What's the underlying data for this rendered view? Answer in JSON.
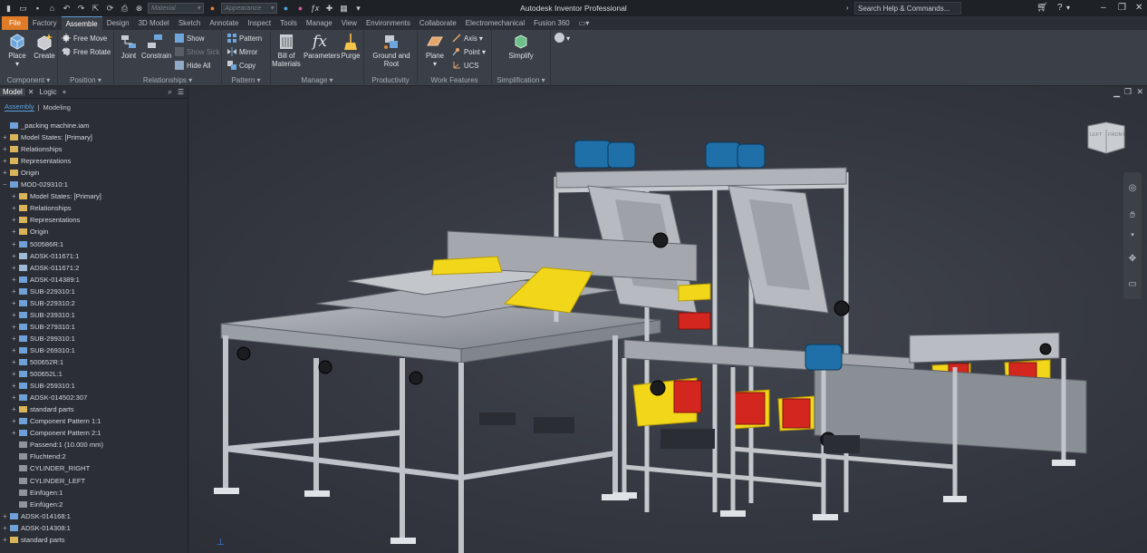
{
  "window": {
    "title": "Autodesk Inventor Professional",
    "search": "Search Help & Commands..."
  },
  "quick_access": {
    "material_placeholder": "Material",
    "appearance_placeholder": "Appearance"
  },
  "tabs": [
    "File",
    "Factory",
    "Assemble",
    "Design",
    "3D Model",
    "Sketch",
    "Annotate",
    "Inspect",
    "Tools",
    "Manage",
    "View",
    "Environments",
    "Collaborate",
    "Electromechanical",
    "Fusion 360"
  ],
  "ribbon": {
    "component": {
      "label": "Component",
      "place": "Place",
      "create": "Create"
    },
    "position": {
      "label": "Position",
      "free_move": "Free Move",
      "free_rotate": "Free Rotate"
    },
    "relationships": {
      "label": "Relationships",
      "joint": "Joint",
      "constrain": "Constrain",
      "show": "Show",
      "show_sick": "Show Sick",
      "hide_all": "Hide All"
    },
    "pattern": {
      "label": "Pattern",
      "pattern": "Pattern",
      "mirror": "Mirror",
      "copy": "Copy"
    },
    "manage": {
      "label": "Manage",
      "bom": "Bill of Materials",
      "parameters": "Parameters",
      "purge": "Purge"
    },
    "productivity": {
      "label": "Productivity",
      "ground_root": "Ground and Root"
    },
    "work_features": {
      "label": "Work Features",
      "plane": "Plane",
      "axis": "Axis",
      "point": "Point",
      "ucs": "UCS"
    },
    "simplification": {
      "label": "Simplification",
      "simplify": "Simplify"
    }
  },
  "browser": {
    "tab_model": "Model",
    "tab_logic": "Logic",
    "sub_assembly": "Assembly",
    "sub_modeling": "Modeling",
    "tree": [
      {
        "label": "_packing machine.iam",
        "level": 0,
        "icon": "asm",
        "pm": ""
      },
      {
        "label": "Model States: [Primary]",
        "level": 0,
        "icon": "folder",
        "pm": "+"
      },
      {
        "label": "Relationships",
        "level": 0,
        "icon": "folder",
        "pm": "+"
      },
      {
        "label": "Representations",
        "level": 0,
        "icon": "folder",
        "pm": "+"
      },
      {
        "label": "Origin",
        "level": 0,
        "icon": "folder",
        "pm": "+"
      },
      {
        "label": "MOD-029310:1",
        "level": 0,
        "icon": "asm",
        "pm": "−"
      },
      {
        "label": "Model States: [Primary]",
        "level": 1,
        "icon": "folder",
        "pm": "+"
      },
      {
        "label": "Relationships",
        "level": 1,
        "icon": "folder",
        "pm": "+"
      },
      {
        "label": "Representations",
        "level": 1,
        "icon": "folder",
        "pm": "+"
      },
      {
        "label": "Origin",
        "level": 1,
        "icon": "folder",
        "pm": "+"
      },
      {
        "label": "500586R:1",
        "level": 1,
        "icon": "asm",
        "pm": "+"
      },
      {
        "label": "ADSK-011671:1",
        "level": 1,
        "icon": "part",
        "pm": "+"
      },
      {
        "label": "ADSK-011671:2",
        "level": 1,
        "icon": "part",
        "pm": "+"
      },
      {
        "label": "ADSK-014389:1",
        "level": 1,
        "icon": "asm",
        "pm": "+"
      },
      {
        "label": "SUB-229310:1",
        "level": 1,
        "icon": "asm",
        "pm": "+"
      },
      {
        "label": "SUB-229310:2",
        "level": 1,
        "icon": "asm",
        "pm": "+"
      },
      {
        "label": "SUB-239310:1",
        "level": 1,
        "icon": "asm",
        "pm": "+"
      },
      {
        "label": "SUB-279310:1",
        "level": 1,
        "icon": "asm",
        "pm": "+"
      },
      {
        "label": "SUB-299310:1",
        "level": 1,
        "icon": "asm",
        "pm": "+"
      },
      {
        "label": "SUB-269310:1",
        "level": 1,
        "icon": "asm",
        "pm": "+"
      },
      {
        "label": "500652R:1",
        "level": 1,
        "icon": "asm",
        "pm": "+"
      },
      {
        "label": "500652L:1",
        "level": 1,
        "icon": "asm",
        "pm": "+"
      },
      {
        "label": "SUB-259310:1",
        "level": 1,
        "icon": "asm",
        "pm": "+"
      },
      {
        "label": "ADSK-014502:307",
        "level": 1,
        "icon": "asm",
        "pm": "+"
      },
      {
        "label": "standard parts",
        "level": 1,
        "icon": "folder",
        "pm": "+"
      },
      {
        "label": "Component Pattern 1:1",
        "level": 1,
        "icon": "asm",
        "pm": "+"
      },
      {
        "label": "Component Pattern 2:1",
        "level": 1,
        "icon": "asm",
        "pm": "+"
      },
      {
        "label": "Passend:1 (10.000 mm)",
        "level": 1,
        "icon": "sk",
        "pm": ""
      },
      {
        "label": "Fluchtend:2",
        "level": 1,
        "icon": "sk",
        "pm": ""
      },
      {
        "label": "CYLINDER_RIGHT",
        "level": 1,
        "icon": "sk",
        "pm": ""
      },
      {
        "label": "CYLINDER_LEFT",
        "level": 1,
        "icon": "sk",
        "pm": ""
      },
      {
        "label": "Einfügen:1",
        "level": 1,
        "icon": "sk",
        "pm": ""
      },
      {
        "label": "Einfügen:2",
        "level": 1,
        "icon": "sk",
        "pm": ""
      },
      {
        "label": "ADSK-014168:1",
        "level": 0,
        "icon": "asm",
        "pm": "+"
      },
      {
        "label": "ADSK-014308:1",
        "level": 0,
        "icon": "asm",
        "pm": "+"
      },
      {
        "label": "standard parts",
        "level": 0,
        "icon": "folder",
        "pm": "+"
      }
    ]
  },
  "viewcube": {
    "left": "LEFT",
    "front": "FRONT"
  },
  "colors": {
    "accent": "#e07b27",
    "active_tab": "#5b9bd5",
    "yellow_parts": "#f2d61a",
    "motor_blue": "#1f6fa8",
    "frame": "#b8bcc2"
  }
}
